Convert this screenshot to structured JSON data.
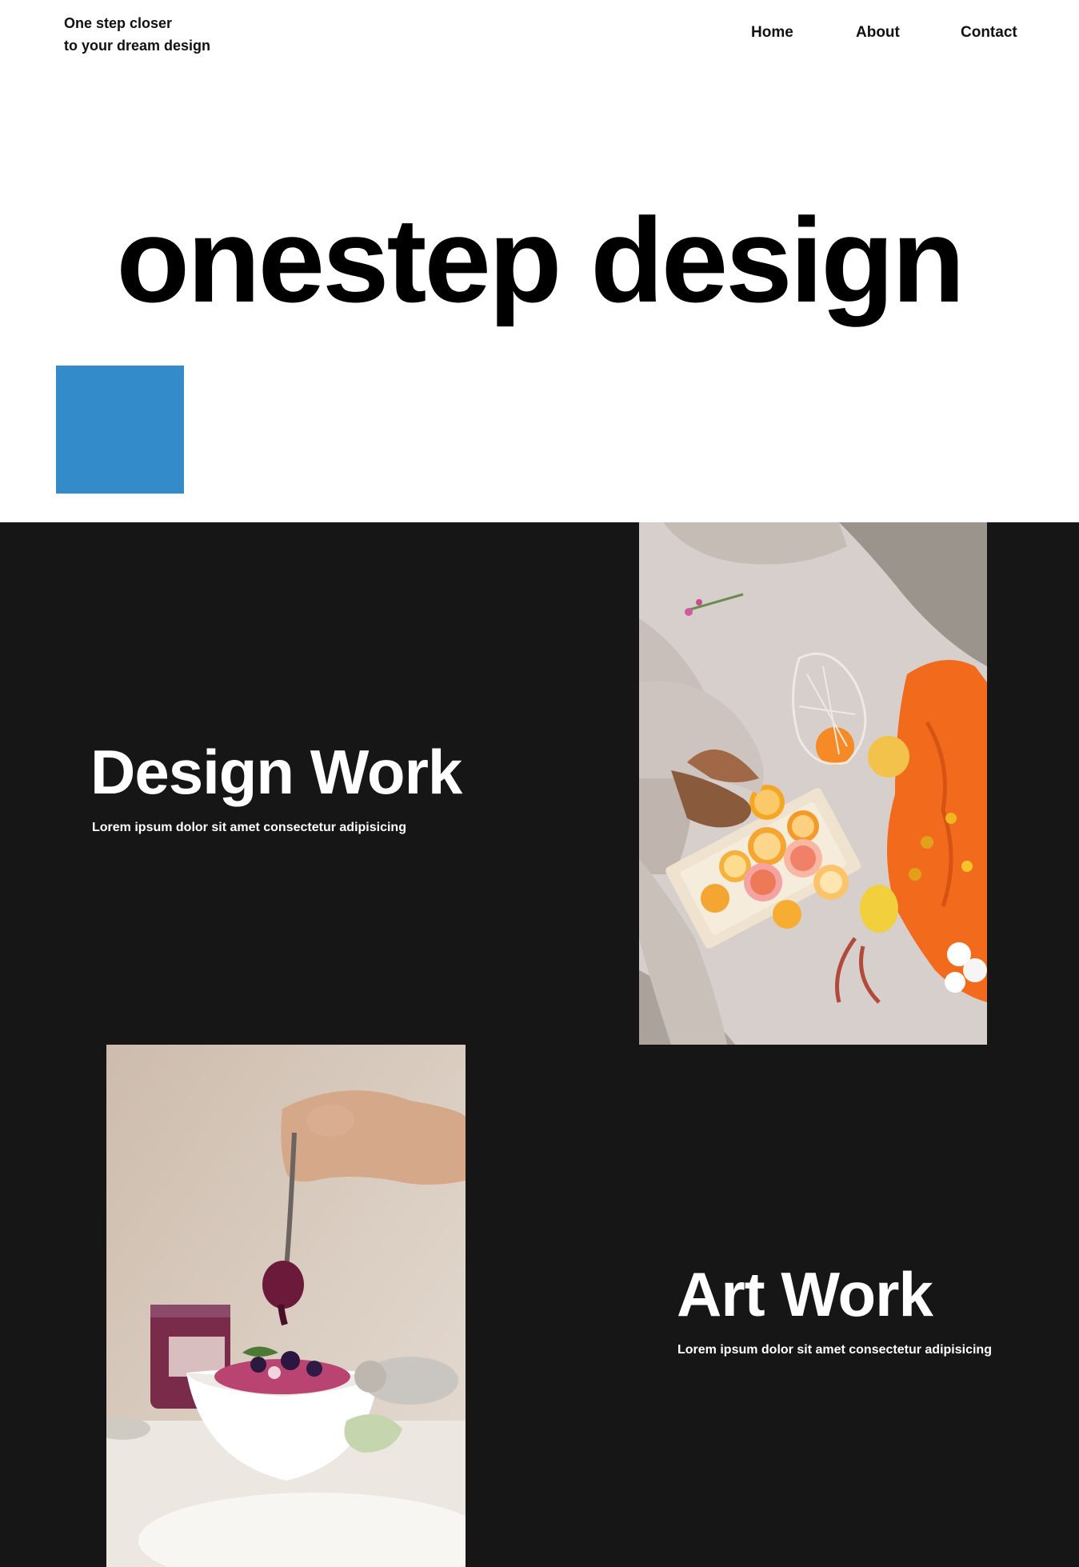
{
  "header": {
    "tagline_line1": "One step closer",
    "tagline_line2": "to your dream design",
    "nav": [
      "Home",
      "About",
      "Contact"
    ]
  },
  "hero": {
    "title": "onestep design",
    "accent_color": "#338bc9"
  },
  "sections": [
    {
      "title": "Design Work",
      "description": "Lorem ipsum dolor sit amet consectetur adipisicing"
    },
    {
      "title": "Art Work",
      "description": "Lorem ipsum dolor sit amet consectetur adipisicing"
    }
  ],
  "colors": {
    "dark_bg": "#161616",
    "text": "#111111"
  }
}
